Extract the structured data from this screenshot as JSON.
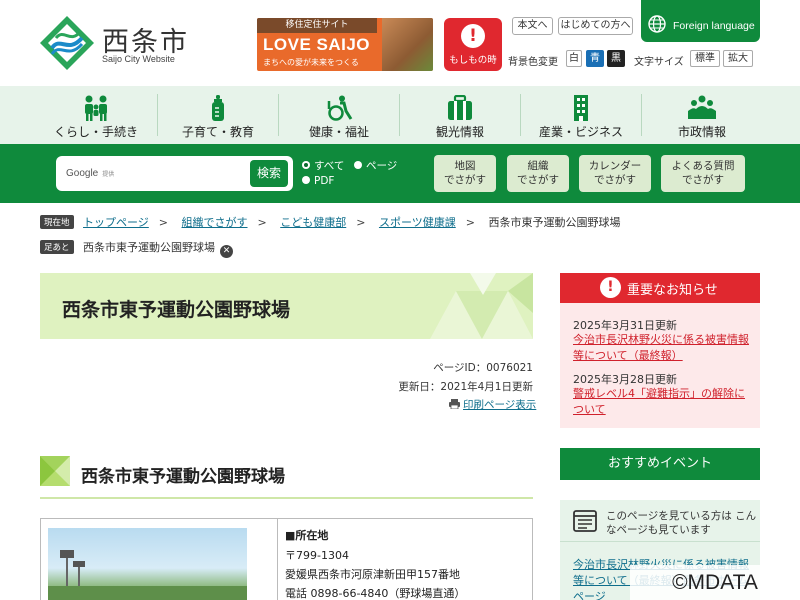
{
  "header": {
    "site_title": "西条市",
    "site_subtitle": "Saijo City Website",
    "banner": {
      "top": "移住定住サイト",
      "main": "LOVE SAIJO",
      "sub": "まちへの愛が未来をつくる"
    },
    "emergency_label": "もしもの時",
    "text_only_label": "本文へ",
    "first_time_label": "はじめての方へ",
    "foreign_language_label": "Foreign language",
    "bg_color_label": "背景色変更",
    "bg_options": [
      "白",
      "青",
      "黒"
    ],
    "font_size_label": "文字サイズ",
    "font_options": [
      "標準",
      "拡大"
    ]
  },
  "gnav": [
    {
      "label": "くらし・手続き",
      "icon": "people-icon"
    },
    {
      "label": "子育て・教育",
      "icon": "baby-bottle-icon"
    },
    {
      "label": "健康・福祉",
      "icon": "wheelchair-icon"
    },
    {
      "label": "観光情報",
      "icon": "suitcase-icon"
    },
    {
      "label": "産業・ビジネス",
      "icon": "building-icon"
    },
    {
      "label": "市政情報",
      "icon": "group-icon"
    }
  ],
  "search": {
    "google_label": "Google",
    "google_sub": "提供",
    "button": "検索",
    "scope_all": "すべて",
    "scope_page": "ページ",
    "scope_pdf": "PDF"
  },
  "finders": [
    {
      "line1": "地図",
      "line2": "でさがす"
    },
    {
      "line1": "組織",
      "line2": "でさがす"
    },
    {
      "line1": "カレンダー",
      "line2": "でさがす"
    },
    {
      "line1": "よくある質問",
      "line2": "でさがす"
    }
  ],
  "breadcrumb": {
    "current_tag": "現在地",
    "items": [
      "トップページ",
      "組織でさがす",
      "こども健康部",
      "スポーツ健康課"
    ],
    "current": "西条市東予運動公園野球場",
    "history_tag": "足あと",
    "history_item": "西条市東予運動公園野球場"
  },
  "page": {
    "title": "西条市東予運動公園野球場",
    "page_id": "ページID：0076021",
    "updated": "更新日：2021年4月1日更新",
    "print_label": "印刷ページ表示",
    "section_heading": "西条市東予運動公園野球場",
    "info": {
      "location_heading": "■所在地",
      "postal": "〒799-1304",
      "address": "愛媛県西条市河原津新田甲157番地",
      "phone": "電話  0898-66-4840（野球場直通）"
    }
  },
  "notice": {
    "title": "重要なお知らせ",
    "items": [
      {
        "date": "2025年3月31日更新",
        "text": "今治市長沢林野火災に係る被害情報等について（最終報）"
      },
      {
        "date": "2025年3月28日更新",
        "text": "警戒レベル4「避難指示」の解除について"
      }
    ]
  },
  "events_label": "おすすめイベント",
  "related": {
    "title": "このページを見ている方は こんなページも見ています",
    "link": "今治市長沢林野火災に係る被害情報等について（最終報）西条市ホームページ"
  },
  "copyright": "©MDATA",
  "colors": {
    "brand_green": "#0f8a3c",
    "alert_red": "#e0282f",
    "nav_bg": "#e7f3ea",
    "title_bg": "#dff2c0"
  }
}
